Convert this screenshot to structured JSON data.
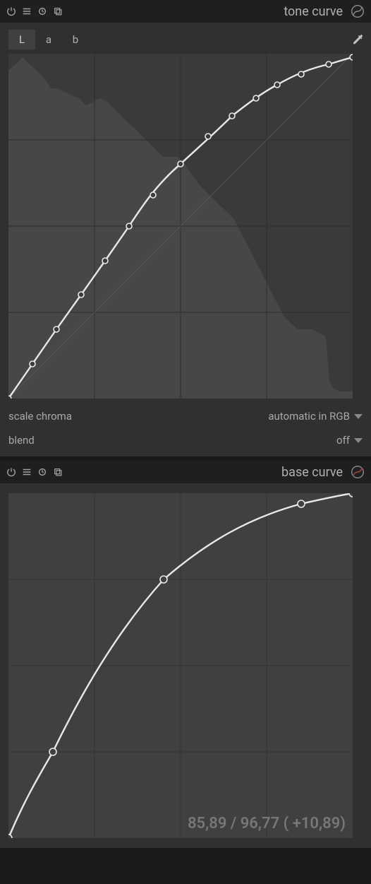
{
  "tone_curve": {
    "title": "tone curve",
    "tabs": {
      "L": "L",
      "a": "a",
      "b": "b",
      "active": "L"
    },
    "scale_chroma": {
      "label": "scale chroma",
      "value": "automatic in RGB"
    },
    "blend": {
      "label": "blend",
      "value": "off"
    }
  },
  "base_curve": {
    "title": "base curve",
    "readout": "85,89 / 96,77 ( +10,89)"
  },
  "chart_data": [
    {
      "type": "line",
      "title": "tone curve L channel",
      "xlabel": "",
      "ylabel": "",
      "xlim": [
        0,
        1
      ],
      "ylim": [
        0,
        1
      ],
      "grid": "4x4",
      "histogram": [
        0.95,
        0.97,
        0.99,
        0.97,
        0.95,
        0.93,
        0.9,
        0.9,
        0.89,
        0.88,
        0.87,
        0.85,
        0.86,
        0.87,
        0.86,
        0.84,
        0.82,
        0.8,
        0.78,
        0.76,
        0.74,
        0.72,
        0.7,
        0.7,
        0.7,
        0.68,
        0.65,
        0.62,
        0.6,
        0.58,
        0.56,
        0.54,
        0.52,
        0.48,
        0.44,
        0.4,
        0.36,
        0.32,
        0.28,
        0.24,
        0.22,
        0.2,
        0.2,
        0.2,
        0.19,
        0.18,
        0.05,
        0.03,
        0.02,
        0.02
      ],
      "diagonal": true,
      "series": [
        {
          "name": "curve",
          "x": [
            0.0,
            0.07,
            0.14,
            0.21,
            0.28,
            0.35,
            0.42,
            0.5,
            0.58,
            0.65,
            0.72,
            0.78,
            0.85,
            0.93,
            1.0
          ],
          "values": [
            0.0,
            0.1,
            0.2,
            0.3,
            0.4,
            0.5,
            0.59,
            0.68,
            0.76,
            0.82,
            0.87,
            0.91,
            0.94,
            0.97,
            0.99
          ]
        }
      ]
    },
    {
      "type": "line",
      "title": "base curve",
      "xlabel": "",
      "ylabel": "",
      "xlim": [
        0,
        1
      ],
      "ylim": [
        0,
        1
      ],
      "grid": "4x4",
      "diagonal": false,
      "overlay_text": "85,89 / 96,77 ( +10,89)",
      "series": [
        {
          "name": "curve",
          "x": [
            0.0,
            0.13,
            0.45,
            0.85,
            1.0
          ],
          "values": [
            0.0,
            0.25,
            0.75,
            0.97,
            1.0
          ]
        }
      ]
    }
  ]
}
